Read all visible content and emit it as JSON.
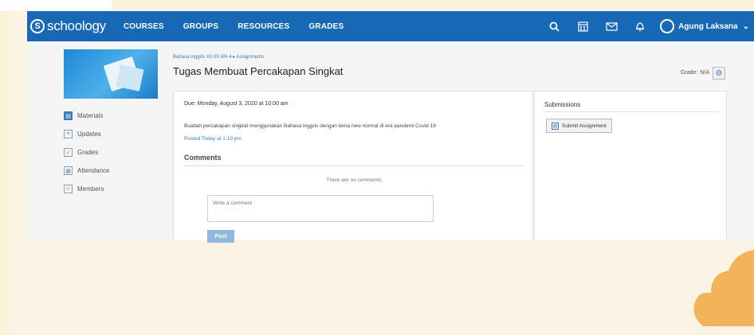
{
  "navbar": {
    "logo_text": "schoology",
    "logo_mark": "S",
    "links": [
      "COURSES",
      "GROUPS",
      "RESOURCES",
      "GRADES"
    ],
    "icons": [
      "search-icon",
      "calendar-icon",
      "mail-icon",
      "bell-icon"
    ],
    "user_name": "Agung Laksana",
    "caret": "⌄"
  },
  "course": {
    "breadcrumb": "Bahasa Inggris XII IIS IPA 4 ▸ Assignments",
    "title": "Tugas Membuat Percakapan Singkat",
    "grade_label": "Grade:",
    "grade_value": "N/A"
  },
  "sidebar": {
    "items": [
      {
        "label": "Materials",
        "icon": "materials-icon"
      },
      {
        "label": "Updates",
        "icon": "updates-icon"
      },
      {
        "label": "Grades",
        "icon": "grades-icon"
      },
      {
        "label": "Attendance",
        "icon": "attendance-icon"
      },
      {
        "label": "Members",
        "icon": "members-icon"
      }
    ]
  },
  "assignment": {
    "due": "Due: Monday, August 3, 2020 at 10:00 am",
    "description": "Buatlah percakapan singkat menggunakan Bahasa Inggris dengan tema new normal di era pandemi Covid 19",
    "posted": "Posted Today at 1:19 pm",
    "comments_heading": "Comments",
    "no_comments": "There are no comments",
    "comment_placeholder": "Write a comment",
    "post_label": "Post"
  },
  "submissions": {
    "heading": "Submissions",
    "submit_label": "Submit Assignment"
  },
  "colors": {
    "nav_blue": "#1769b5",
    "link_blue": "#3a7cc1",
    "background_cream": "#fdf1d8",
    "cloud_orange": "#f2b35a"
  }
}
